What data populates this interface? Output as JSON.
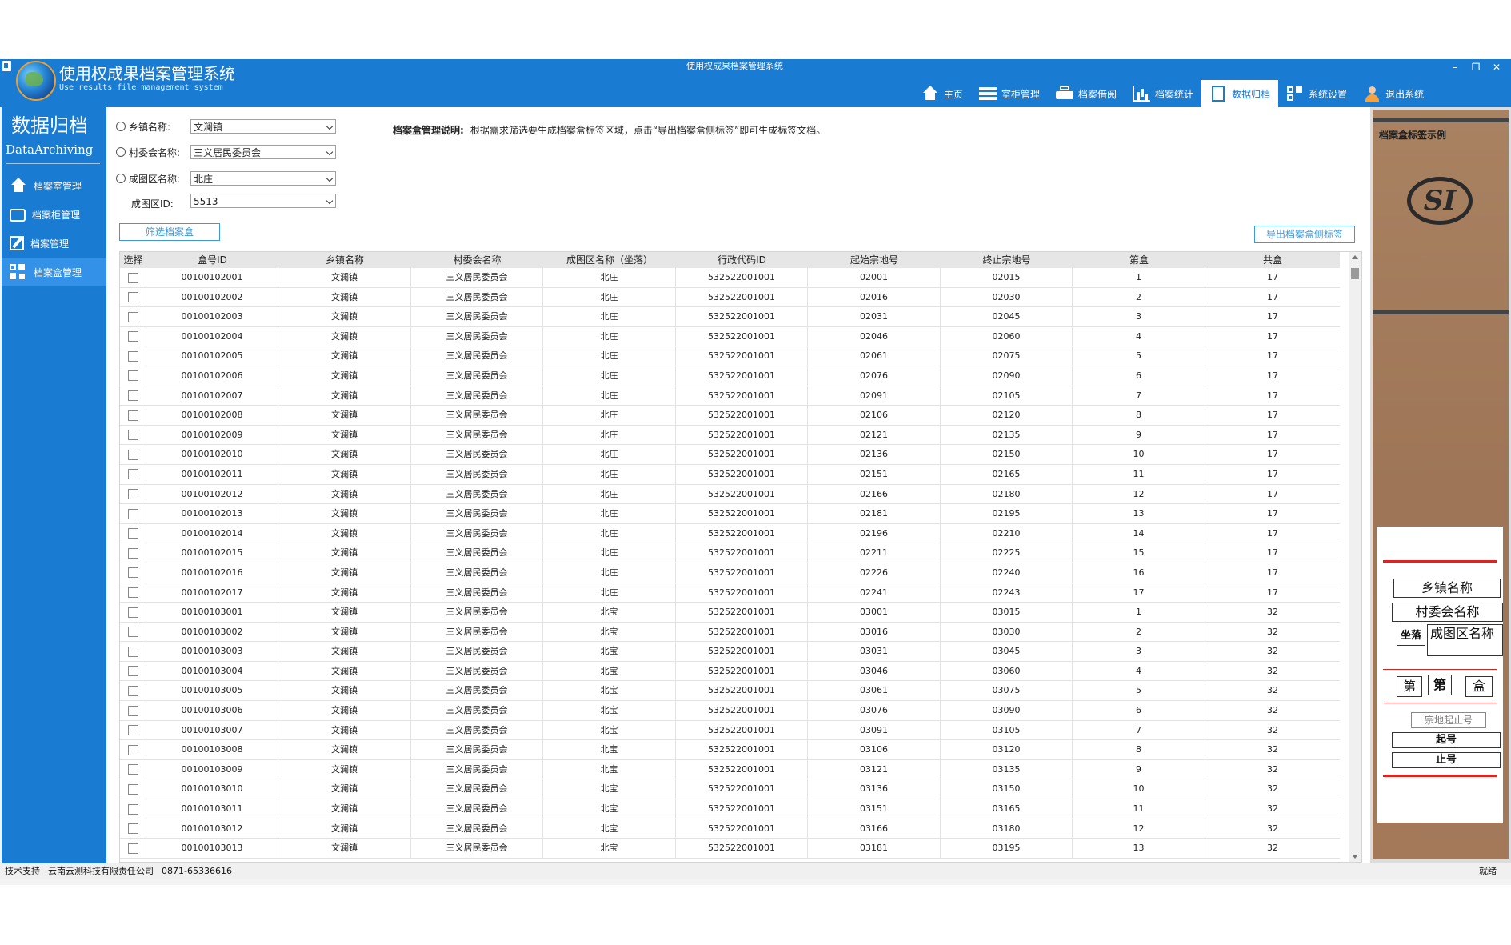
{
  "window": {
    "title": "使用权成果档案管理系统",
    "controls": [
      "–",
      "❐",
      "✕"
    ]
  },
  "header": {
    "app_title": "使用权成果档案管理系统",
    "app_subtitle": "Use results file management system",
    "nav": [
      {
        "label": "主页",
        "icon": "home-icon"
      },
      {
        "label": "室柜管理",
        "icon": "cabinet-icon"
      },
      {
        "label": "档案借阅",
        "icon": "printer-icon"
      },
      {
        "label": "档案统计",
        "icon": "bar-chart-icon"
      },
      {
        "label": "数据归档",
        "icon": "document-icon",
        "active": true
      },
      {
        "label": "系统设置",
        "icon": "grid-icon"
      },
      {
        "label": "退出系统",
        "icon": "user-icon"
      }
    ]
  },
  "sidebar": {
    "title": "数据归档",
    "subtitle": "DataArchiving",
    "items": [
      {
        "label": "档案室管理",
        "icon": "home-icon"
      },
      {
        "label": "档案柜管理",
        "icon": "tray-icon"
      },
      {
        "label": "档案管理",
        "icon": "edit-icon"
      },
      {
        "label": "档案盒管理",
        "icon": "qr-icon",
        "active": true
      }
    ]
  },
  "filters": {
    "town": {
      "label": "乡镇名称:",
      "value": "文澜镇"
    },
    "village": {
      "label": "村委会名称:",
      "value": "三义居民委员会"
    },
    "area": {
      "label": "成图区名称:",
      "value": "北庄"
    },
    "area_id": {
      "label": "成图区ID:",
      "value": "5513"
    },
    "filter_button": "筛选档案盒"
  },
  "instructions": {
    "heading": "档案盒管理说明:",
    "text": "根据需求筛选要生成档案盒标签区域，点击“导出档案盒侧标签”即可生成标签文档。"
  },
  "export_button": "导出档案盒侧标签",
  "table": {
    "columns": [
      "选择",
      "盒号ID",
      "乡镇名称",
      "村委会名称",
      "成图区名称（坐落）",
      "行政代码ID",
      "起始宗地号",
      "终止宗地号",
      "第盒",
      "共盒"
    ],
    "rows": [
      [
        "00100102001",
        "文澜镇",
        "三义居民委员会",
        "北庄",
        "532522001001",
        "02001",
        "02015",
        "1",
        "17"
      ],
      [
        "00100102002",
        "文澜镇",
        "三义居民委员会",
        "北庄",
        "532522001001",
        "02016",
        "02030",
        "2",
        "17"
      ],
      [
        "00100102003",
        "文澜镇",
        "三义居民委员会",
        "北庄",
        "532522001001",
        "02031",
        "02045",
        "3",
        "17"
      ],
      [
        "00100102004",
        "文澜镇",
        "三义居民委员会",
        "北庄",
        "532522001001",
        "02046",
        "02060",
        "4",
        "17"
      ],
      [
        "00100102005",
        "文澜镇",
        "三义居民委员会",
        "北庄",
        "532522001001",
        "02061",
        "02075",
        "5",
        "17"
      ],
      [
        "00100102006",
        "文澜镇",
        "三义居民委员会",
        "北庄",
        "532522001001",
        "02076",
        "02090",
        "6",
        "17"
      ],
      [
        "00100102007",
        "文澜镇",
        "三义居民委员会",
        "北庄",
        "532522001001",
        "02091",
        "02105",
        "7",
        "17"
      ],
      [
        "00100102008",
        "文澜镇",
        "三义居民委员会",
        "北庄",
        "532522001001",
        "02106",
        "02120",
        "8",
        "17"
      ],
      [
        "00100102009",
        "文澜镇",
        "三义居民委员会",
        "北庄",
        "532522001001",
        "02121",
        "02135",
        "9",
        "17"
      ],
      [
        "00100102010",
        "文澜镇",
        "三义居民委员会",
        "北庄",
        "532522001001",
        "02136",
        "02150",
        "10",
        "17"
      ],
      [
        "00100102011",
        "文澜镇",
        "三义居民委员会",
        "北庄",
        "532522001001",
        "02151",
        "02165",
        "11",
        "17"
      ],
      [
        "00100102012",
        "文澜镇",
        "三义居民委员会",
        "北庄",
        "532522001001",
        "02166",
        "02180",
        "12",
        "17"
      ],
      [
        "00100102013",
        "文澜镇",
        "三义居民委员会",
        "北庄",
        "532522001001",
        "02181",
        "02195",
        "13",
        "17"
      ],
      [
        "00100102014",
        "文澜镇",
        "三义居民委员会",
        "北庄",
        "532522001001",
        "02196",
        "02210",
        "14",
        "17"
      ],
      [
        "00100102015",
        "文澜镇",
        "三义居民委员会",
        "北庄",
        "532522001001",
        "02211",
        "02225",
        "15",
        "17"
      ],
      [
        "00100102016",
        "文澜镇",
        "三义居民委员会",
        "北庄",
        "532522001001",
        "02226",
        "02240",
        "16",
        "17"
      ],
      [
        "00100102017",
        "文澜镇",
        "三义居民委员会",
        "北庄",
        "532522001001",
        "02241",
        "02243",
        "17",
        "17"
      ],
      [
        "00100103001",
        "文澜镇",
        "三义居民委员会",
        "北宝",
        "532522001001",
        "03001",
        "03015",
        "1",
        "32"
      ],
      [
        "00100103002",
        "文澜镇",
        "三义居民委员会",
        "北宝",
        "532522001001",
        "03016",
        "03030",
        "2",
        "32"
      ],
      [
        "00100103003",
        "文澜镇",
        "三义居民委员会",
        "北宝",
        "532522001001",
        "03031",
        "03045",
        "3",
        "32"
      ],
      [
        "00100103004",
        "文澜镇",
        "三义居民委员会",
        "北宝",
        "532522001001",
        "03046",
        "03060",
        "4",
        "32"
      ],
      [
        "00100103005",
        "文澜镇",
        "三义居民委员会",
        "北宝",
        "532522001001",
        "03061",
        "03075",
        "5",
        "32"
      ],
      [
        "00100103006",
        "文澜镇",
        "三义居民委员会",
        "北宝",
        "532522001001",
        "03076",
        "03090",
        "6",
        "32"
      ],
      [
        "00100103007",
        "文澜镇",
        "三义居民委员会",
        "北宝",
        "532522001001",
        "03091",
        "03105",
        "7",
        "32"
      ],
      [
        "00100103008",
        "文澜镇",
        "三义居民委员会",
        "北宝",
        "532522001001",
        "03106",
        "03120",
        "8",
        "32"
      ],
      [
        "00100103009",
        "文澜镇",
        "三义居民委员会",
        "北宝",
        "532522001001",
        "03121",
        "03135",
        "9",
        "32"
      ],
      [
        "00100103010",
        "文澜镇",
        "三义居民委员会",
        "北宝",
        "532522001001",
        "03136",
        "03150",
        "10",
        "32"
      ],
      [
        "00100103011",
        "文澜镇",
        "三义居民委员会",
        "北宝",
        "532522001001",
        "03151",
        "03165",
        "11",
        "32"
      ],
      [
        "00100103012",
        "文澜镇",
        "三义居民委员会",
        "北宝",
        "532522001001",
        "03166",
        "03180",
        "12",
        "32"
      ],
      [
        "00100103013",
        "文澜镇",
        "三义居民委员会",
        "北宝",
        "532522001001",
        "03181",
        "03195",
        "13",
        "32"
      ]
    ]
  },
  "label_example": {
    "title": "档案盒标签示例",
    "seal_text": "SI",
    "town": "乡镇名称",
    "village": "村委会名称",
    "located": "坐落",
    "area": "成图区名称",
    "di": "第",
    "di_value": "第",
    "he": "盒",
    "parcel_range": "宗地起止号",
    "start": "起号",
    "end": "止号"
  },
  "statusbar": {
    "support_label": "技术支持",
    "company": "云南云测科技有限责任公司",
    "phone": "0871-65336616",
    "status": "就绪"
  },
  "colors": {
    "primary": "#1a7bd3",
    "accent_outline": "#3a9ad9",
    "kraft": "#a3795a",
    "label_red": "#dd2222"
  }
}
